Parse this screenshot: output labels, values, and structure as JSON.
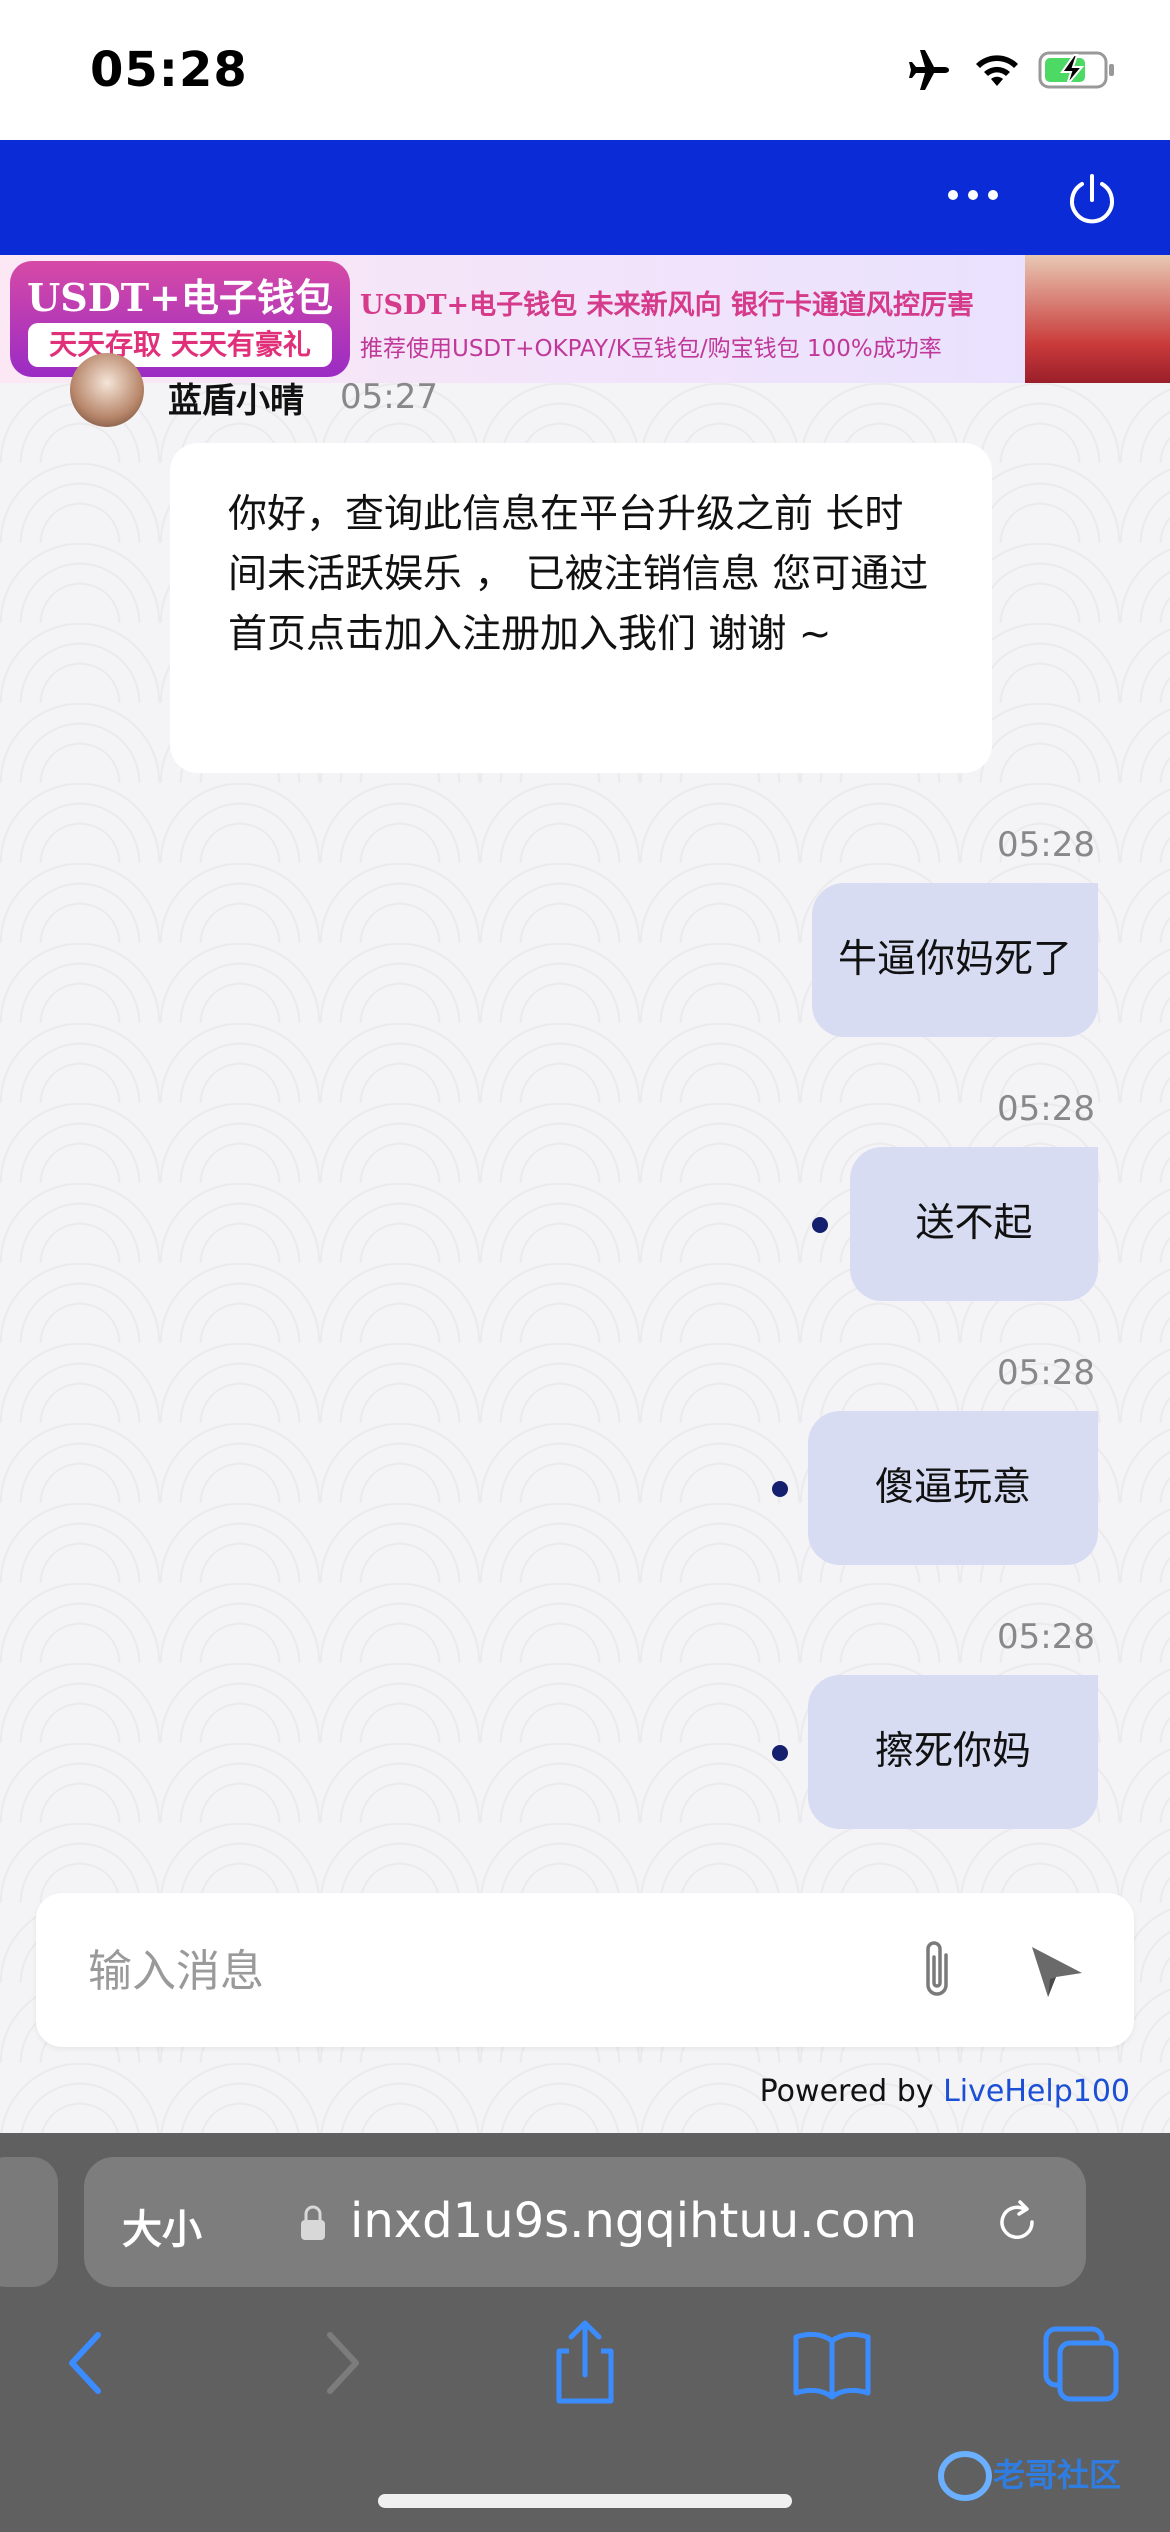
{
  "status_bar": {
    "time": "05:28"
  },
  "header": {
    "more_icon": "more-dots-icon",
    "power_icon": "power-icon"
  },
  "banner": {
    "left_title": "USDT+电子钱包",
    "left_subtitle": "天天存取 天天有豪礼",
    "headline": "USDT+电子钱包   未来新风向   银行卡通道风控厉害",
    "subline": "推荐使用USDT+OKPAY/K豆钱包/购宝钱包    100%成功率"
  },
  "chat": {
    "agent": {
      "name": "蓝盾小晴",
      "time": "05:27",
      "message": "你好，查询此信息在平台升级之前 长时间未活跃娱乐 ，  已被注销信息 您可通过首页点击加入注册加入我们 谢谢 ~"
    },
    "messages": [
      {
        "time": "05:28",
        "text": "牛逼你妈死了"
      },
      {
        "time": "05:28",
        "text": "送不起"
      },
      {
        "time": "05:28",
        "text": "傻逼玩意"
      },
      {
        "time": "05:28",
        "text": "擦死你妈"
      }
    ]
  },
  "composer": {
    "placeholder": "输入消息",
    "attach_icon": "paperclip-icon",
    "send_icon": "send-icon"
  },
  "footer": {
    "powered_prefix": "Powered by ",
    "powered_brand": "LiveHelp100"
  },
  "browser": {
    "text_size_label": "大小",
    "url": "inxd1u9s.ngqihtuu.com",
    "watermark": "老哥社区"
  },
  "colors": {
    "header_blue": "#0a2bd6",
    "bubble_mine": "#d7dcf2",
    "ios_blue": "#3b8cff"
  }
}
